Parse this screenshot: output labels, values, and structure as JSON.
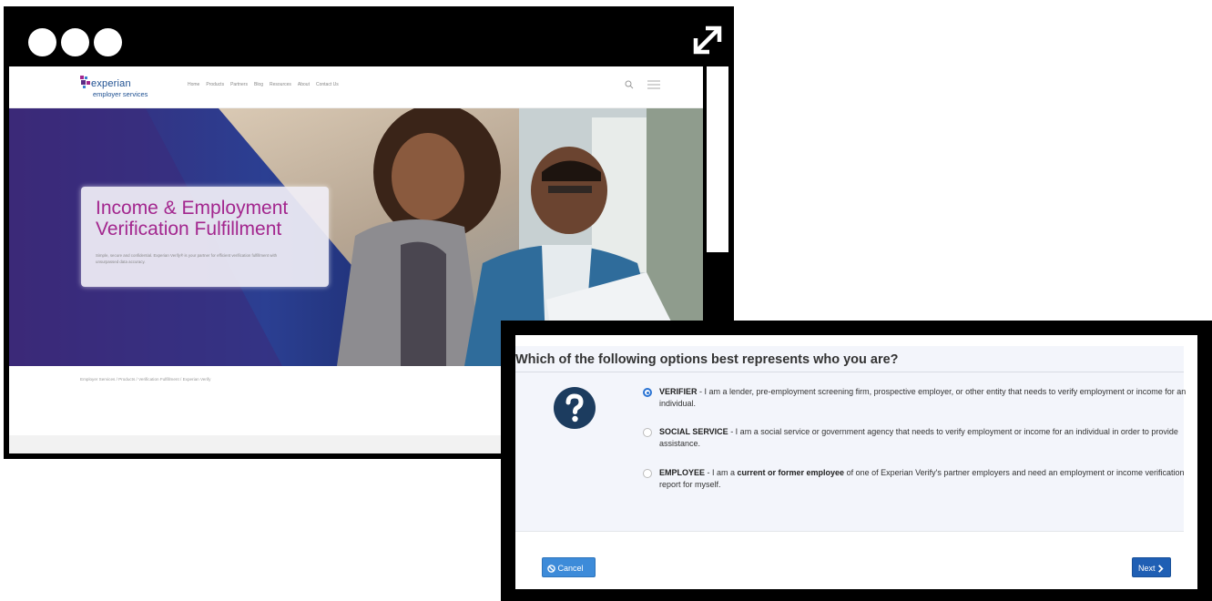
{
  "website": {
    "logo": {
      "name": "experian",
      "sub": "employer services"
    },
    "nav_links": [
      "Home",
      "Products",
      "Partners",
      "Blog",
      "Resources",
      "About",
      "Contact Us"
    ],
    "hero": {
      "title_line1": "Income & Employment",
      "title_line2": "Verification Fulfillment",
      "body": "Simple, secure and confidential. Experian Verify® is your partner for efficient verification fulfillment with unsurpassed data accuracy."
    },
    "breadcrumb": "Employer Services / Products / Verification Fulfillment / Experian Verify"
  },
  "dialog": {
    "question": "Which of the following options best represents who you are?",
    "options": [
      {
        "label": "VERIFIER",
        "text": " - I am a lender, pre-employment screening firm, prospective employer, or other entity that needs to verify employment or income for an individual.",
        "selected": true
      },
      {
        "label": "SOCIAL SERVICE",
        "text": " - I am a social service or government agency that needs to verify employment or income for an individual in order to provide assistance.",
        "selected": false
      },
      {
        "label": "EMPLOYEE",
        "text_before": " - I am a ",
        "emphasis": "current or former employee",
        "text_after": " of one of Experian Verify's partner employers and need an employment or income verification report for myself.",
        "selected": false
      }
    ],
    "cancel_label": "Cancel",
    "next_label": "Next"
  },
  "colors": {
    "accent_blue": "#1f5fb4",
    "hero_title": "#a3268e",
    "question_icon": "#1c3c5f"
  }
}
